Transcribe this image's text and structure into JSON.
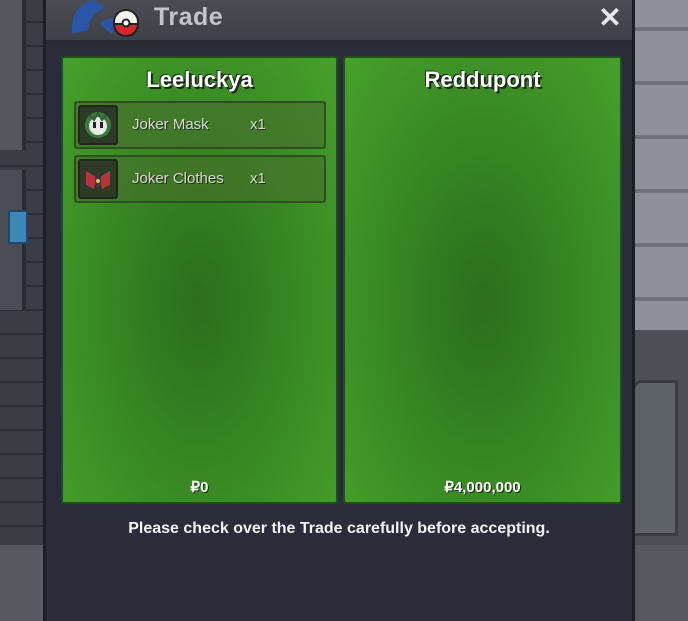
{
  "window": {
    "title": "Trade",
    "close_label": "✕"
  },
  "left_party": {
    "name": "Leeluckya",
    "money": "₽0",
    "items": [
      {
        "name": "Joker Mask",
        "qty": "x1",
        "icon": "joker-mask-icon"
      },
      {
        "name": "Joker Clothes",
        "qty": "x1",
        "icon": "joker-clothes-icon"
      }
    ]
  },
  "right_party": {
    "name": "Reddupont",
    "money": "₽4,000,000",
    "items": []
  },
  "notice": "Please check over the Trade carefully before accepting.",
  "colors": {
    "panel_green": "#398a23",
    "window_bg": "#2a2c3a",
    "titlebar": "#45474f"
  }
}
